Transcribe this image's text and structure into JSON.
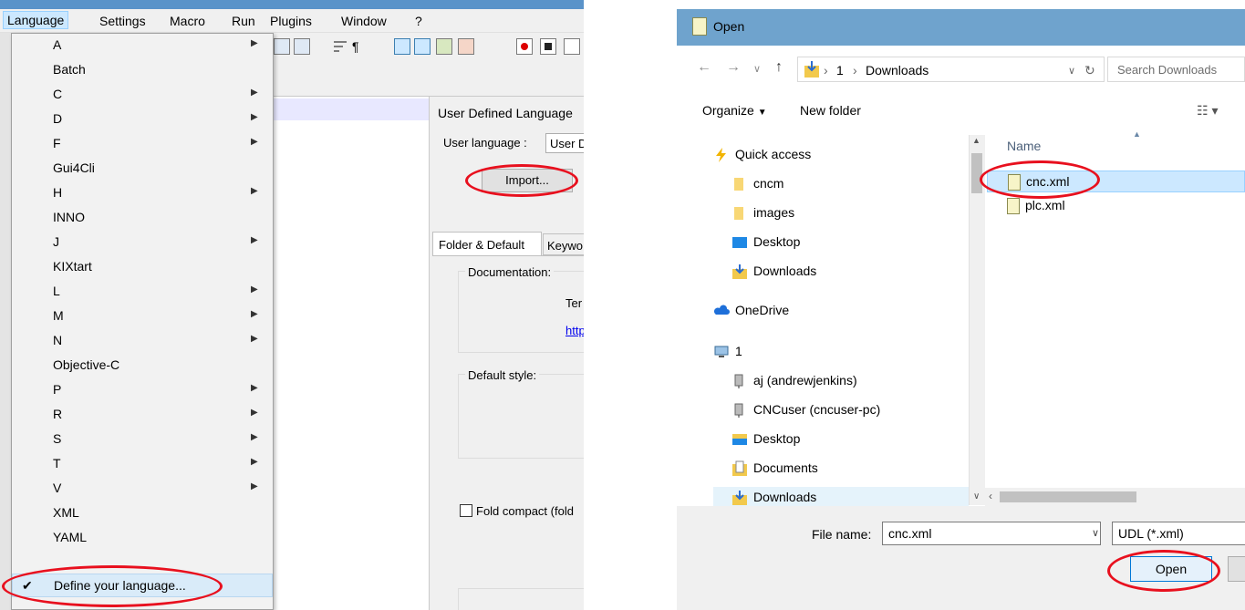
{
  "notepad": {
    "menu": [
      "Language",
      "Settings",
      "Macro",
      "Run",
      "Plugins",
      "Window",
      "?"
    ],
    "language_menu": [
      {
        "label": "A",
        "submenu": true
      },
      {
        "label": "Batch",
        "submenu": false
      },
      {
        "label": "C",
        "submenu": true
      },
      {
        "label": "D",
        "submenu": true
      },
      {
        "label": "F",
        "submenu": true
      },
      {
        "label": "Gui4Cli",
        "submenu": false
      },
      {
        "label": "H",
        "submenu": true
      },
      {
        "label": "INNO",
        "submenu": false
      },
      {
        "label": "J",
        "submenu": true
      },
      {
        "label": "KIXtart",
        "submenu": false
      },
      {
        "label": "L",
        "submenu": true
      },
      {
        "label": "M",
        "submenu": true
      },
      {
        "label": "N",
        "submenu": true
      },
      {
        "label": "Objective-C",
        "submenu": false
      },
      {
        "label": "P",
        "submenu": true
      },
      {
        "label": "R",
        "submenu": true
      },
      {
        "label": "S",
        "submenu": true
      },
      {
        "label": "T",
        "submenu": true
      },
      {
        "label": "V",
        "submenu": true
      },
      {
        "label": "XML",
        "submenu": false
      },
      {
        "label": "YAML",
        "submenu": false
      },
      {
        "label": "Define your language...",
        "submenu": false,
        "checked": true
      }
    ],
    "udl": {
      "title": "User Defined Language",
      "user_language_label": "User language :",
      "user_language_value": "User D",
      "import_button": "Import...",
      "tab_folder": "Folder & Default",
      "tab_keywords": "Keywo",
      "documentation_label": "Documentation:",
      "doc_text": "Ter",
      "doc_link": "http",
      "default_style_label": "Default style:",
      "fold_compact_label": "Fold compact (fold"
    }
  },
  "open_dialog": {
    "title": "Open",
    "breadcrumb": [
      "1",
      "Downloads"
    ],
    "search_placeholder": "Search Downloads",
    "organize_label": "Organize",
    "new_folder_label": "New folder",
    "nav_items": [
      {
        "label": "Quick access",
        "icon": "lightning-icon"
      },
      {
        "label": "cncm",
        "icon": "folder-icon"
      },
      {
        "label": "images",
        "icon": "folder-icon"
      },
      {
        "label": "Desktop",
        "icon": "desktop-icon"
      },
      {
        "label": "Downloads",
        "icon": "downloads-icon"
      },
      {
        "label": "OneDrive",
        "icon": "cloud-icon"
      },
      {
        "label": "1",
        "icon": "computer-icon"
      },
      {
        "label": "aj (andrewjenkins)",
        "icon": "network-icon"
      },
      {
        "label": "CNCuser (cncuser-pc)",
        "icon": "network-icon"
      },
      {
        "label": "Desktop",
        "icon": "desktop-icon"
      },
      {
        "label": "Documents",
        "icon": "documents-icon"
      },
      {
        "label": "Downloads",
        "icon": "downloads-icon"
      }
    ],
    "column_name": "Name",
    "files": [
      {
        "name": "cnc.xml",
        "selected": true
      },
      {
        "name": "plc.xml",
        "selected": false
      }
    ],
    "file_name_label": "File name:",
    "file_name_value": "cnc.xml",
    "file_type": "UDL (*.xml)",
    "open_button": "Open"
  },
  "colors": {
    "highlight_red": "#e8101e",
    "title_blue": "#6fa3cd",
    "selection_blue": "#cce8ff"
  }
}
